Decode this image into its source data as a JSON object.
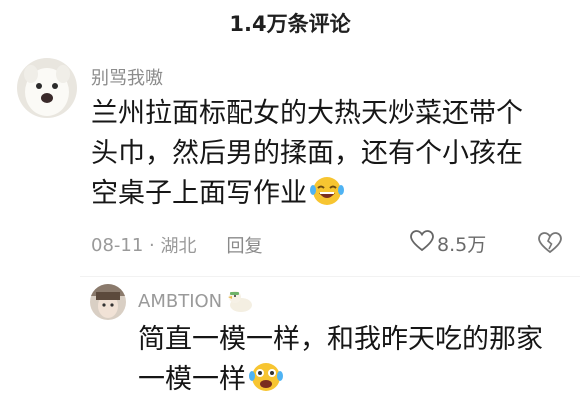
{
  "header": {
    "title": "1.4万条评论"
  },
  "comment": {
    "avatar": "white-dog-avatar",
    "username": "别骂我嗷",
    "lines": [
      "兰州拉面标配女的大热天炒菜还带个",
      "头巾，然后男的揉面，还有个小孩在",
      "空桌子上面写作业"
    ],
    "emoji": "laughing-crying-emoji",
    "date": "08-11",
    "location": "湖北",
    "reply_label": "回复",
    "like_count": "8.5万",
    "like_icon": "heart-outline-icon",
    "dislike_icon": "broken-heart-icon"
  },
  "reply": {
    "avatar": "anime-avatar",
    "username": "AMBTION",
    "badge": "duck-badge-icon",
    "lines": [
      "简直一模一样，和我昨天吃的那家",
      "一模一样"
    ],
    "emoji": "laughing-crying-emoji"
  },
  "colors": {
    "text": "#161616",
    "muted": "#9a9a9a",
    "emoji_yellow": "#f7c531"
  }
}
